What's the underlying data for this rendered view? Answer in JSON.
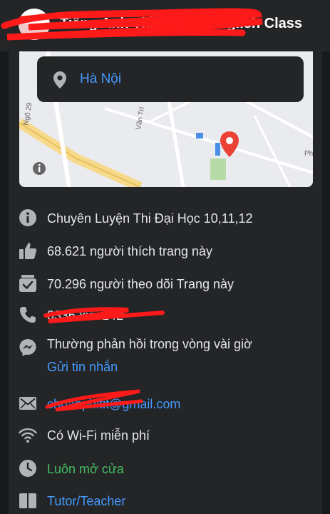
{
  "header": {
    "page_name": "Tiếng Anh Thầy Trịnh English Class"
  },
  "map": {
    "location_label": "Hà Nội",
    "street_label_1": "Ngõ 29",
    "street_label_2": "Văn Trì",
    "place_label": "Ph"
  },
  "info": {
    "category": "Chuyên Luyện Thi Đại Học 10,11,12",
    "likes": "68.621 người thích trang này",
    "followers": "70.296 người theo dõi Trang này",
    "phone": "0336 xxx 142",
    "response_time": "Thường phản hồi trong vòng vài giờ",
    "send_message": "Gửi tin nhắn",
    "email": "chuanphitit@gmail.com",
    "wifi": "Có Wi-Fi miễn phí",
    "hours": "Luôn mở cửa",
    "page_type": "Tutor/Teacher"
  },
  "colors": {
    "link": "#4599ff",
    "open_green": "#45bd62",
    "pin_red": "#ea4335",
    "icon_gray": "#b0b3b8",
    "redaction_red": "#ff1a1a"
  },
  "icons": [
    "map-pin-icon",
    "info-icon",
    "thumbs-up-icon",
    "follow-check-icon",
    "phone-icon",
    "messenger-icon",
    "mail-icon",
    "wifi-icon",
    "clock-icon",
    "briefcase-icon"
  ]
}
